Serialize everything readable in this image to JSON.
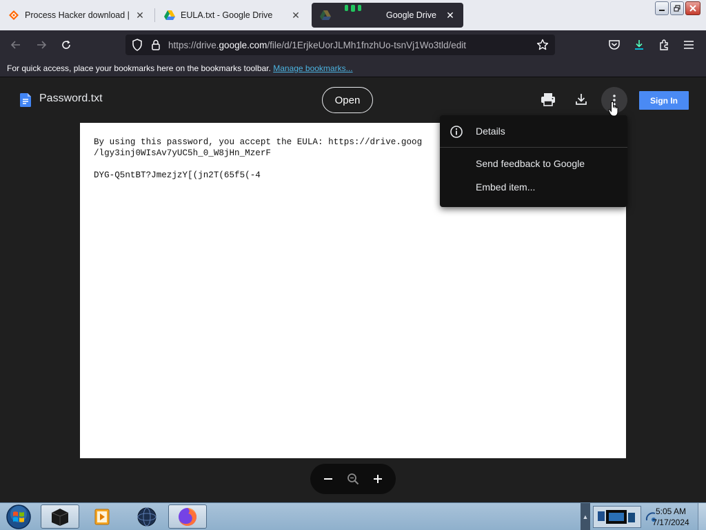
{
  "tabs": [
    {
      "title": "Process Hacker download | Sou",
      "icon": "sourceforge-icon"
    },
    {
      "title": "EULA.txt - Google Drive",
      "icon": "google-drive-icon"
    },
    {
      "title": "Google Drive",
      "icon": "google-drive-icon",
      "active": true
    }
  ],
  "urlbar": {
    "url_prefix": "https://drive.",
    "url_domain": "google.com",
    "url_suffix": "/file/d/1ErjkeUorJLMh1fnzhUo-tsnVj1Wo3tld/edit"
  },
  "bookmarks": {
    "message": "For quick access, place your bookmarks here on the bookmarks toolbar.",
    "link": "Manage bookmarks..."
  },
  "viewer": {
    "file_name": "Password.txt",
    "open_label": "Open",
    "signin_label": "Sign In",
    "document_text": "By using this password, you accept the EULA: https://drive.goog\n/lgy3inj0WIsAv7yUC5h_0_W8jHn_MzerF\n\nDYG-Q5ntBT?JmezjzY[(jn2T(65f5(-4"
  },
  "menu": {
    "items": [
      {
        "label": "Details",
        "icon": "info-icon"
      },
      {
        "label": "Send feedback to Google"
      },
      {
        "label": "Embed item..."
      }
    ]
  },
  "taskbar": {
    "time": "5:05 AM",
    "date": "7/17/2024"
  },
  "colors": {
    "accent_blue": "#4a8af4",
    "viewer_bg": "#1f1f1f",
    "menu_bg": "#121212",
    "browser_chrome": "#2b2a33"
  }
}
